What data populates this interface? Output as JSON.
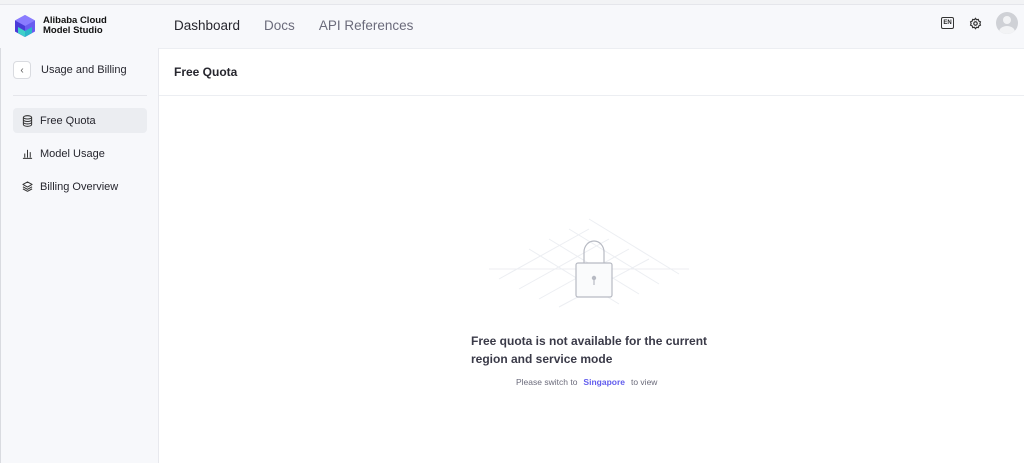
{
  "brand": {
    "line1": "Alibaba Cloud",
    "line2": "Model Studio"
  },
  "nav": [
    {
      "label": "Dashboard",
      "active": true
    },
    {
      "label": "Docs",
      "active": false
    },
    {
      "label": "API References",
      "active": false
    }
  ],
  "toolbar": {
    "language_code": "EN"
  },
  "sidebar": {
    "back_label": "Usage and Billing",
    "items": [
      {
        "label": "Free Quota",
        "icon": "database-icon",
        "active": true
      },
      {
        "label": "Model Usage",
        "icon": "bar-chart-icon",
        "active": false
      },
      {
        "label": "Billing Overview",
        "icon": "layers-icon",
        "active": false
      }
    ]
  },
  "main": {
    "title": "Free Quota",
    "empty_state": {
      "title": "Free quota is not available for the current region and service mode",
      "hint_prefix": "Please switch to",
      "hint_link": "Singapore",
      "hint_suffix": "to view"
    }
  },
  "colors": {
    "accent": "#615ced",
    "background": "#f7f8fb",
    "panel": "#ffffff"
  }
}
